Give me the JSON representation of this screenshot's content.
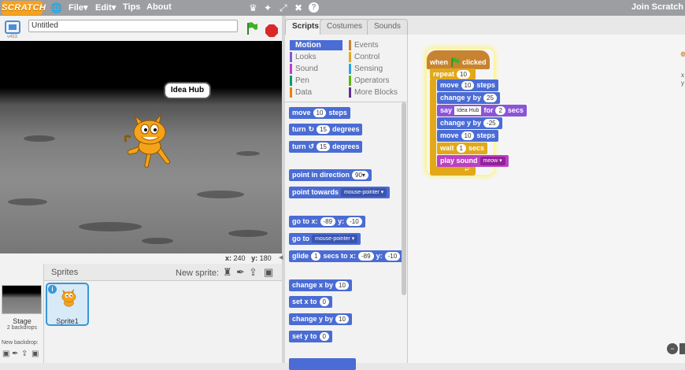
{
  "topbar": {
    "logo": "SCRATCH",
    "menu": [
      "File▾",
      "Edit▾",
      "Tips",
      "About"
    ],
    "join": "Join Scratch"
  },
  "project": {
    "title": "Untitled",
    "version": "v453"
  },
  "stage": {
    "speech": "Idea Hub",
    "x_label": "x:",
    "x_value": "240",
    "y_label": "y:",
    "y_value": "180"
  },
  "sprites_panel": {
    "title": "Sprites",
    "new_sprite": "New sprite:",
    "stage_label": "Stage",
    "stage_backdrops": "2 backdrops",
    "new_backdrop": "New backdrop:",
    "sprite_name": "Sprite1"
  },
  "tabs": [
    "Scripts",
    "Costumes",
    "Sounds"
  ],
  "categories": [
    {
      "label": "Motion",
      "color": "#4a6cd4"
    },
    {
      "label": "Events",
      "color": "#c88330"
    },
    {
      "label": "Looks",
      "color": "#8a55d7"
    },
    {
      "label": "Control",
      "color": "#e1a91a"
    },
    {
      "label": "Sound",
      "color": "#bb42c3"
    },
    {
      "label": "Sensing",
      "color": "#2ca5e2"
    },
    {
      "label": "Pen",
      "color": "#0e9a6c"
    },
    {
      "label": "Operators",
      "color": "#5cb712"
    },
    {
      "label": "Data",
      "color": "#ee7d16"
    },
    {
      "label": "More Blocks",
      "color": "#632d99"
    }
  ],
  "palette_blocks": {
    "move": [
      "move",
      "10",
      "steps"
    ],
    "turn_cw": [
      "turn",
      "15",
      "degrees"
    ],
    "turn_ccw": [
      "turn",
      "15",
      "degrees"
    ],
    "point_dir": [
      "point in direction",
      "90▾"
    ],
    "point_towards": [
      "point towards",
      "mouse-pointer ▾"
    ],
    "goto_xy": [
      "go to x:",
      "-89",
      "y:",
      "-10"
    ],
    "goto": [
      "go to",
      "mouse-pointer ▾"
    ],
    "glide": [
      "glide",
      "1",
      "secs to x:",
      "-89",
      "y:",
      "-10"
    ],
    "change_x": [
      "change x by",
      "10"
    ],
    "set_x": [
      "set x to",
      "0"
    ],
    "change_y": [
      "change y by",
      "10"
    ],
    "set_y": [
      "set y to",
      "0"
    ]
  },
  "script": {
    "hat": [
      "when",
      "clicked"
    ],
    "repeat": [
      "repeat",
      "10"
    ],
    "b1": [
      "move",
      "10",
      "steps"
    ],
    "b2": [
      "change y by",
      "25"
    ],
    "b3": [
      "say",
      "Idea Hub",
      "for",
      "2",
      "secs"
    ],
    "b4": [
      "change y by",
      "-25"
    ],
    "b5": [
      "move",
      "10",
      "steps"
    ],
    "b6": [
      "wait",
      "1",
      "secs"
    ],
    "b7": [
      "play sound",
      "meow ▾"
    ]
  }
}
